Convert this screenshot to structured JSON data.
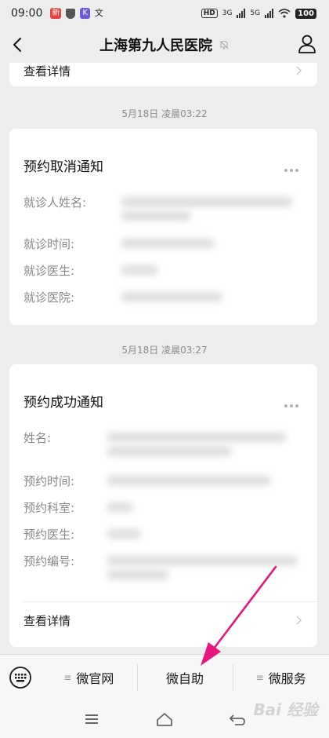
{
  "status_bar": {
    "time": "09:00",
    "icon_news": "新",
    "icon_k": "K",
    "icon_text": "文",
    "hd1": "HD",
    "net1": "3G",
    "net2": "5G",
    "battery": "100"
  },
  "nav": {
    "title": "上海第九人民医院"
  },
  "chat": {
    "prev_detail_label": "查看详情",
    "messages": [
      {
        "timestamp": "5月18日 凌晨03:22",
        "title": "预约取消通知",
        "fields": [
          {
            "label": "就诊人姓名:"
          },
          {
            "label": "就诊时间:"
          },
          {
            "label": "就诊医生:"
          },
          {
            "label": "就诊医院:"
          }
        ]
      },
      {
        "timestamp": "5月18日 凌晨03:27",
        "title": "预约成功通知",
        "fields": [
          {
            "label": "姓名:"
          },
          {
            "label": "预约时间:"
          },
          {
            "label": "预约科室:"
          },
          {
            "label": "预约医生:"
          },
          {
            "label": "预约编号:"
          }
        ],
        "detail_label": "查看详情"
      }
    ]
  },
  "bottom_menu": {
    "items": [
      "微官网",
      "微自助",
      "微服务"
    ]
  },
  "watermark": "Bai 经验",
  "colors": {
    "background": "#ededed",
    "annotation_arrow": "#e8157c"
  }
}
